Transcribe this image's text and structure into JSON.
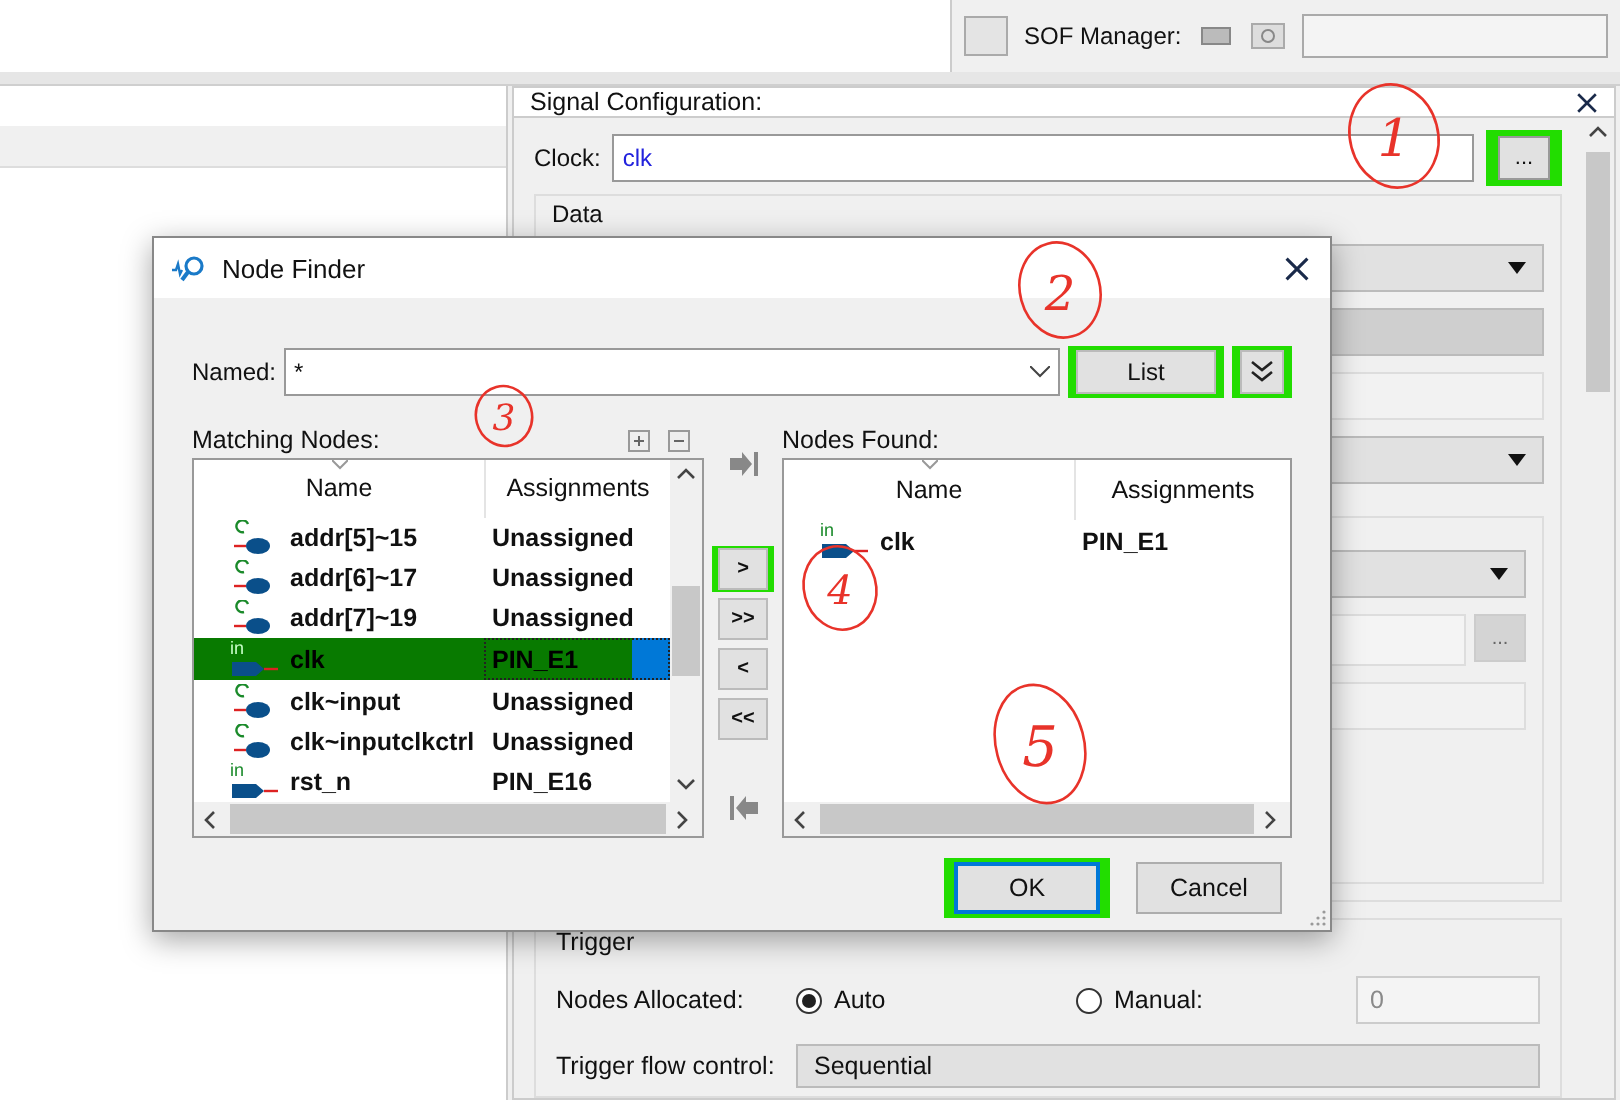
{
  "toolbar": {
    "label": "SOF Manager:"
  },
  "signal_configuration": {
    "title": "Signal Configuration:",
    "clock": {
      "label": "Clock:",
      "value": "clk",
      "browse": "...",
      "highlighted": true
    },
    "data_group": {
      "label": "Data",
      "browse": "..."
    },
    "trigger_group": {
      "label": "Trigger",
      "nodes_allocated": {
        "label": "Nodes Allocated:",
        "options": [
          {
            "label": "Auto",
            "selected": true
          },
          {
            "label": "Manual:",
            "selected": false
          }
        ],
        "value": "0",
        "disabled": true
      },
      "flow_control": {
        "label": "Trigger flow control:",
        "value": "Sequential"
      }
    }
  },
  "dialog": {
    "title": "Node Finder",
    "named": {
      "label": "Named:",
      "value": "*"
    },
    "list_button": {
      "label": "List",
      "highlighted": true
    },
    "options_button": {
      "highlighted": true
    },
    "matching_nodes": {
      "label": "Matching Nodes:",
      "columns": [
        "Name",
        "Assignments"
      ],
      "rows": [
        {
          "name": "addr[5]~15",
          "assignment": "Unassigned",
          "kind": "combinational",
          "selected": false,
          "highlighted": false
        },
        {
          "name": "addr[6]~17",
          "assignment": "Unassigned",
          "kind": "combinational",
          "selected": false,
          "highlighted": false
        },
        {
          "name": "addr[7]~19",
          "assignment": "Unassigned",
          "kind": "combinational",
          "selected": false,
          "highlighted": false
        },
        {
          "name": "clk",
          "assignment": "PIN_E1",
          "kind": "input",
          "pin_label": "in",
          "selected": true,
          "highlighted": true
        },
        {
          "name": "clk~input",
          "assignment": "Unassigned",
          "kind": "combinational",
          "selected": false,
          "highlighted": false
        },
        {
          "name": "clk~inputclkctrl",
          "assignment": "Unassigned",
          "kind": "combinational",
          "selected": false,
          "highlighted": false
        },
        {
          "name": "rst_n",
          "assignment": "PIN_E16",
          "kind": "input",
          "pin_label": "in",
          "selected": false,
          "highlighted": false
        }
      ]
    },
    "move_buttons": [
      {
        "label": ">",
        "highlighted": true
      },
      {
        "label": ">>",
        "highlighted": false
      },
      {
        "label": "<",
        "highlighted": false
      },
      {
        "label": "<<",
        "highlighted": false
      }
    ],
    "nodes_found": {
      "label": "Nodes Found:",
      "columns": [
        "Name",
        "Assignments"
      ],
      "rows": [
        {
          "name": "clk",
          "assignment": "PIN_E1",
          "kind": "input",
          "pin_label": "in",
          "selected": false,
          "highlighted": false
        }
      ]
    },
    "buttons": [
      {
        "label": "OK",
        "highlighted": true,
        "default": true
      },
      {
        "label": "Cancel",
        "highlighted": false,
        "default": false
      }
    ]
  },
  "annotations": [
    {
      "label": "1"
    },
    {
      "label": "2"
    },
    {
      "label": "3"
    },
    {
      "label": "4"
    },
    {
      "label": "5"
    }
  ]
}
